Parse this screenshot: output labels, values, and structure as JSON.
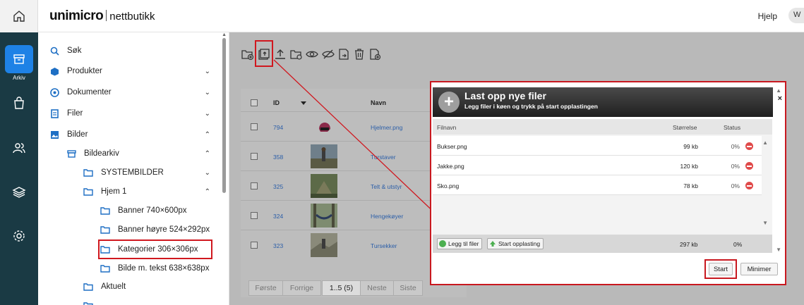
{
  "app": {
    "brand": "unimicro",
    "product": "nettbutikk",
    "help_label": "Hjelp",
    "avatar_initial": "W"
  },
  "rail": {
    "active_label": "Arkiv",
    "items": [
      "home-icon",
      "archive-icon",
      "bag-icon",
      "users-icon",
      "layers-icon",
      "settings-icon"
    ]
  },
  "nav": {
    "items": [
      {
        "label": "Søk",
        "icon": "search-icon"
      },
      {
        "label": "Produkter",
        "icon": "box-icon"
      },
      {
        "label": "Dokumenter",
        "icon": "globe-icon"
      },
      {
        "label": "Filer",
        "icon": "file-icon"
      },
      {
        "label": "Bilder",
        "icon": "image-icon"
      },
      {
        "label": "Bildearkiv",
        "icon": "archive-icon"
      },
      {
        "label": "SYSTEMBILDER",
        "icon": "folder-icon"
      },
      {
        "label": "Hjem 1",
        "icon": "folder-icon"
      },
      {
        "label": "Banner 740×600px",
        "icon": "folder-icon"
      },
      {
        "label": "Banner høyre 524×292px",
        "icon": "folder-icon"
      },
      {
        "label": "Kategorier 306×306px",
        "icon": "folder-icon"
      },
      {
        "label": "Bilde m. tekst 638×638px",
        "icon": "folder-icon"
      },
      {
        "label": "Aktuelt",
        "icon": "folder-icon"
      }
    ]
  },
  "table": {
    "columns": [
      "ID",
      "Navn"
    ],
    "rows": [
      {
        "id": "794",
        "name": "Hjelmer.png"
      },
      {
        "id": "358",
        "name": "Turstaver"
      },
      {
        "id": "325",
        "name": "Telt & utstyr"
      },
      {
        "id": "324",
        "name": "Hengekøyer"
      },
      {
        "id": "323",
        "name": "Tursekker"
      }
    ],
    "pager": [
      "Første",
      "Forrige",
      "1..5 (5)",
      "Neste",
      "Siste"
    ]
  },
  "upload": {
    "title": "Last opp nye filer",
    "subtitle": "Legg filer i køen og trykk på start opplastingen",
    "col_name": "Filnavn",
    "col_size": "Størrelse",
    "col_status": "Status",
    "files": [
      {
        "name": "Bukser.png",
        "size": "99 kb",
        "status": "0%"
      },
      {
        "name": "Jakke.png",
        "size": "120 kb",
        "status": "0%"
      },
      {
        "name": "Sko.png",
        "size": "78 kb",
        "status": "0%"
      }
    ],
    "add_label": "Legg til filer",
    "start_upload_label": "Start opplasting",
    "total_size": "297 kb",
    "total_status": "0%",
    "start_label": "Start",
    "minimize_label": "Minimer",
    "close_label": "×"
  },
  "colors": {
    "rail": "#1a3a44",
    "accent": "#1e82e6",
    "highlight": "#d0181f"
  }
}
